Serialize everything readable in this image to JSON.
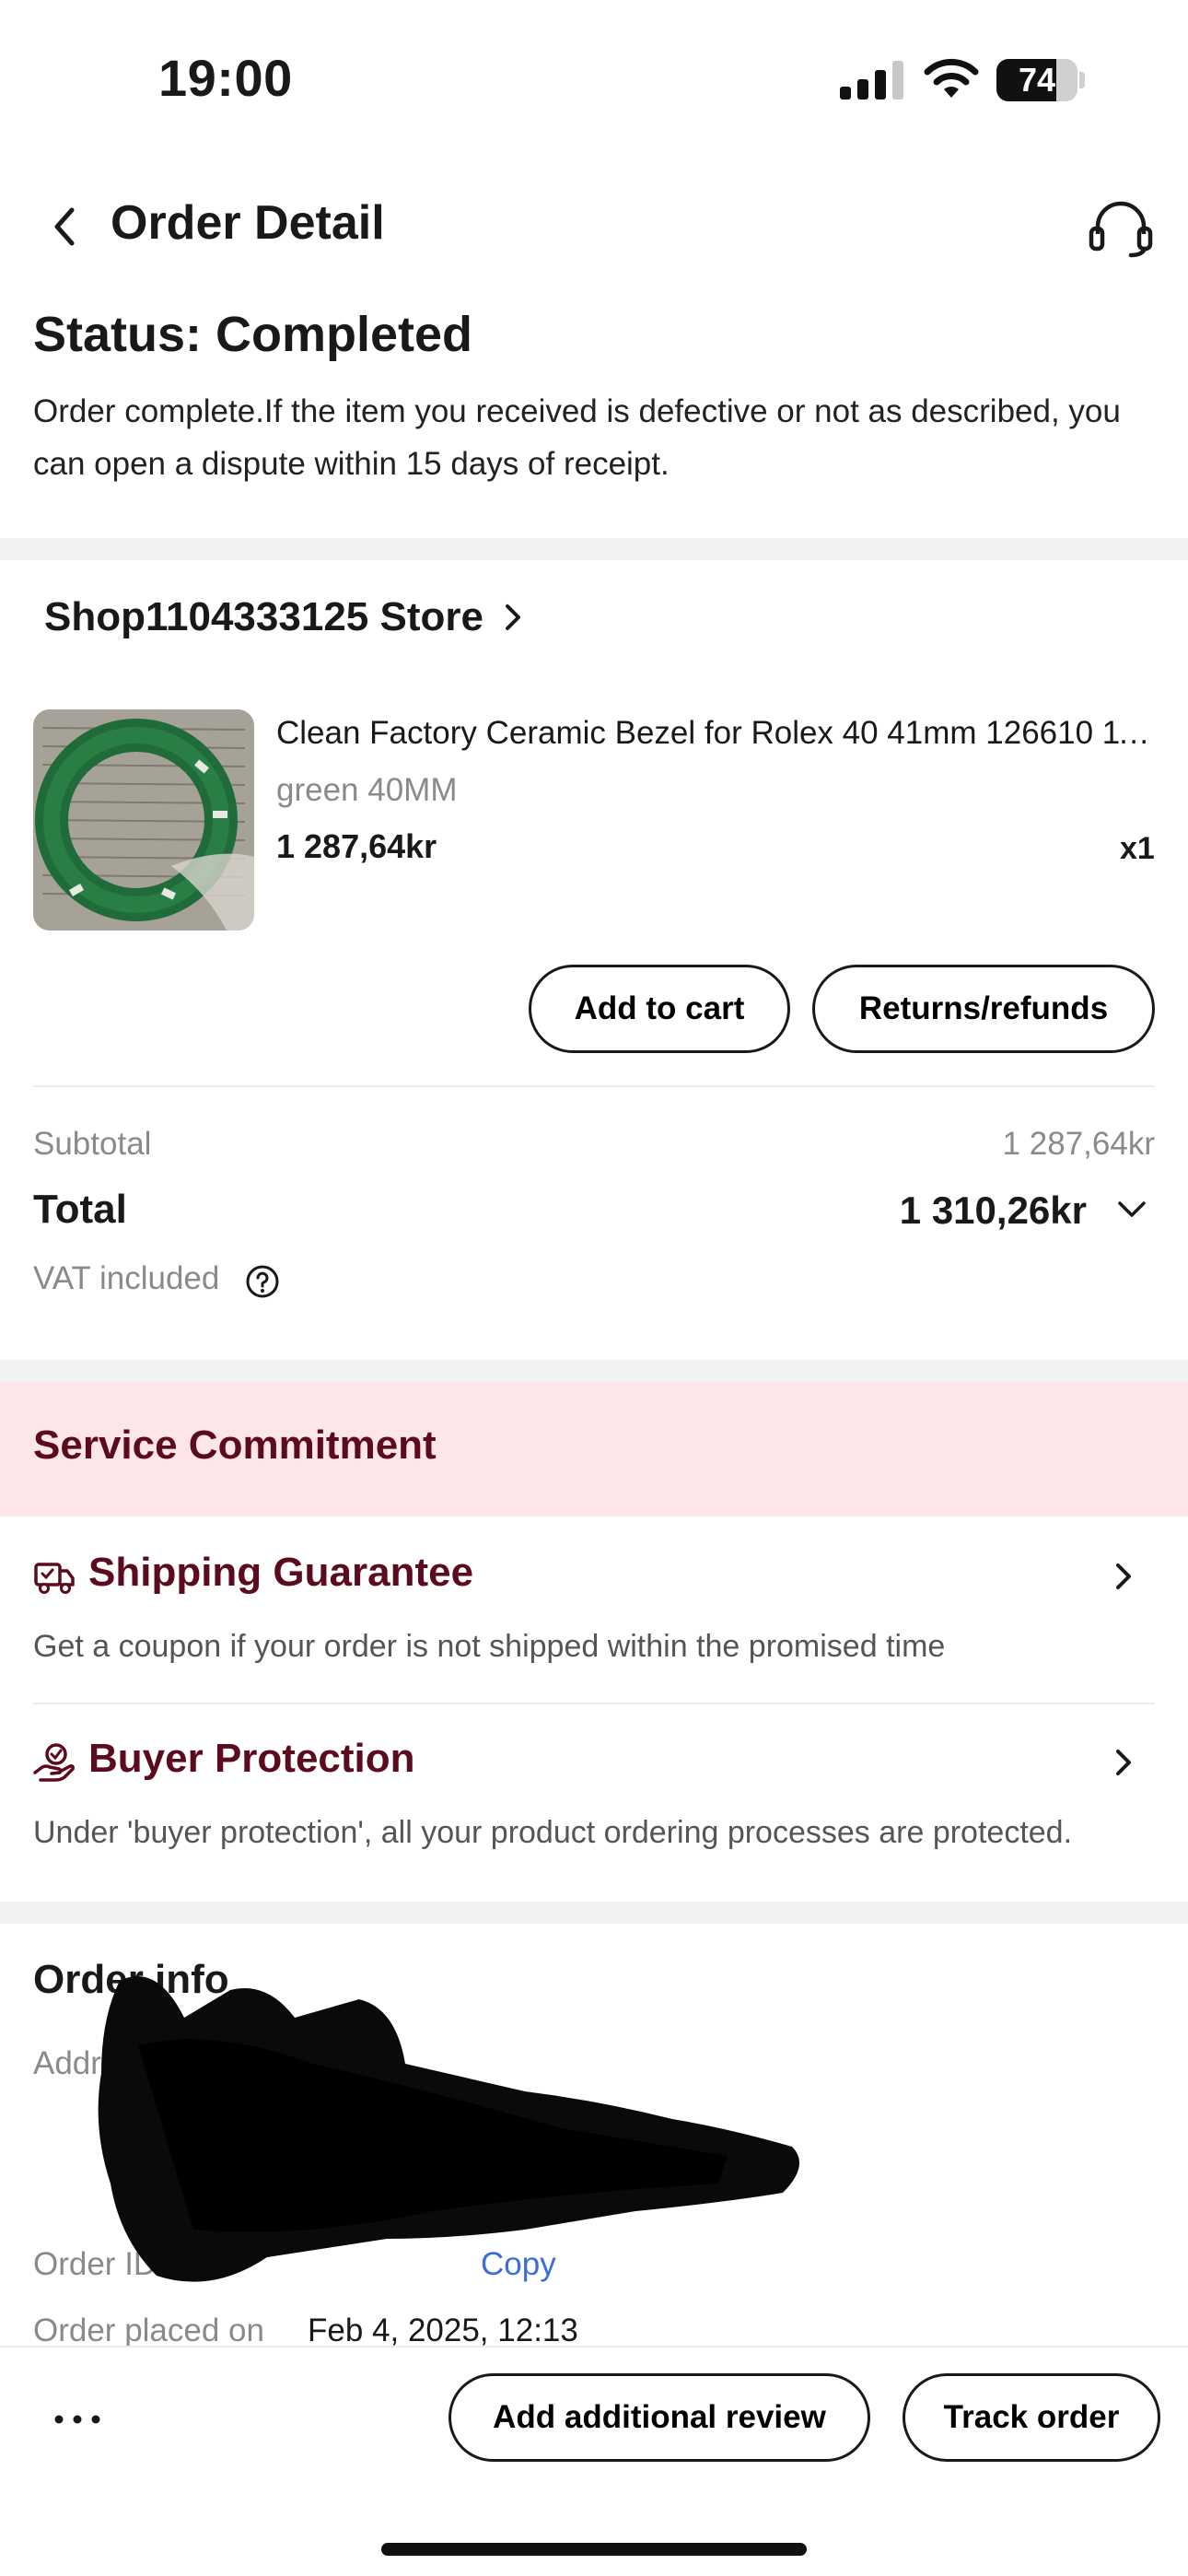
{
  "status_bar": {
    "time": "19:00",
    "battery": "74",
    "battery_level": 0.74,
    "icons": [
      "cellular-signal-icon",
      "wifi-icon",
      "battery-icon"
    ]
  },
  "header": {
    "title": "Order Detail",
    "back_icon": "chevron-left-icon",
    "support_icon": "headset-icon"
  },
  "order_status": {
    "title": "Status: Completed",
    "description": "Order complete.If the item you received is defective or not as described, you can open a dispute within 15 days of receipt."
  },
  "store": {
    "name": "Shop1104333125 Store"
  },
  "product": {
    "title": "Clean Factory Ceramic Bezel for Rolex 40 41mm 126610 11...",
    "variant": "green 40MM",
    "price": "1 287,64kr",
    "quantity": "x1",
    "actions": {
      "add_to_cart": "Add to cart",
      "returns": "Returns/refunds"
    }
  },
  "summary": {
    "subtotal_label": "Subtotal",
    "subtotal_value": "1 287,64kr",
    "total_label": "Total",
    "total_value": "1 310,26kr",
    "vat_label": "VAT included"
  },
  "service": {
    "title": "Service Commitment",
    "items": [
      {
        "title": "Shipping Guarantee",
        "description": "Get a coupon if your order is not shipped within the promised time",
        "icon": "delivery-truck-icon"
      },
      {
        "title": "Buyer Protection",
        "description": "Under 'buyer protection', all your product ordering processes are protected.",
        "icon": "protection-hand-icon"
      }
    ]
  },
  "order_info": {
    "title": "Order info",
    "address_label": "Addres",
    "order_id_label": "Order ID",
    "copy_label": "Copy",
    "placed_label": "Order placed on",
    "placed_value": "Feb 4, 2025, 12:13"
  },
  "bottom_bar": {
    "more_icon": "more-dots-icon",
    "review_label": "Add additional review",
    "track_label": "Track order"
  },
  "colors": {
    "accent_dark_red": "#5c0a1e",
    "commitment_bg": "#fde6e8",
    "link_blue": "#3a6fd8"
  }
}
